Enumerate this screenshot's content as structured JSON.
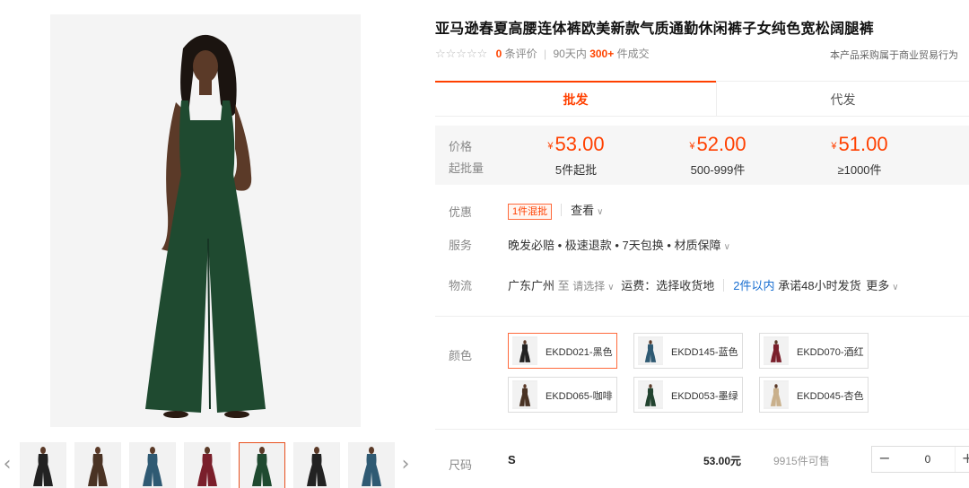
{
  "product": {
    "title": "亚马逊春夏高腰连体裤欧美新款气质通勤休闲裤子女纯色宽松阔腿裤",
    "stars": "☆☆☆☆☆",
    "review_count": "0",
    "review_suffix": "条评价",
    "sold_prefix": "90天内",
    "sold_count": "300+",
    "sold_suffix": "件成交",
    "trade_note": "本产品采购属于商业贸易行为"
  },
  "tabs": {
    "wholesale": "批发",
    "dropship": "代发"
  },
  "price_box": {
    "price_label": "价格",
    "moq_label": "起批量",
    "currency": "¥",
    "tiers": [
      {
        "price": "53.00",
        "qty": "5件起批"
      },
      {
        "price": "52.00",
        "qty": "500-999件"
      },
      {
        "price": "51.00",
        "qty": "≥1000件"
      }
    ]
  },
  "promo": {
    "label": "优惠",
    "tag": "1件混批",
    "view": "查看"
  },
  "service": {
    "label": "服务",
    "text": "晚发必赔 • 极速退款 • 7天包换 • 材质保障"
  },
  "logistics": {
    "label": "物流",
    "origin": "广东广州",
    "to": "至",
    "select": "请选择",
    "freight": "运费：选择收货地",
    "qty_range": "2件以内",
    "promise": "承诺48小时发货",
    "more": "更多"
  },
  "colors": {
    "label": "颜色",
    "options": [
      {
        "name": "EKDD021-黑色",
        "swatch": "#222222"
      },
      {
        "name": "EKDD145-蓝色",
        "swatch": "#2f5a73"
      },
      {
        "name": "EKDD070-酒红",
        "swatch": "#7a1f2b"
      },
      {
        "name": "EKDD065-咖啡",
        "swatch": "#4a3324"
      },
      {
        "name": "EKDD053-墨绿",
        "swatch": "#22432f"
      },
      {
        "name": "EKDD045-杏色",
        "swatch": "#c9b08c"
      }
    ]
  },
  "size": {
    "label": "尺码",
    "value": "S",
    "price": "53.00元",
    "stock": "9915件可售",
    "quantity": "0"
  },
  "gallery": {
    "main_color": "#1f4a30",
    "thumbs": [
      "#222222",
      "#4a3324",
      "#2f5a73",
      "#7a1f2b",
      "#1f4a30",
      "#222222",
      "#2f5a73"
    ],
    "active_index": 4
  }
}
